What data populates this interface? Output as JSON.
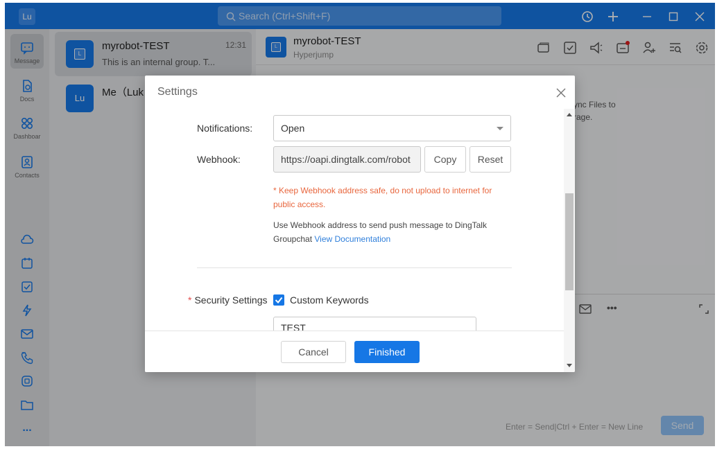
{
  "titlebar": {
    "avatar_text": "Lu",
    "search_placeholder": "Search (Ctrl+Shift+F)",
    "accent_color": "#1677e5",
    "icons": [
      "history-icon",
      "plus-icon",
      "minimize-icon",
      "maximize-icon",
      "close-icon"
    ]
  },
  "nav": {
    "items": [
      {
        "label": "Message",
        "icon": "message-icon"
      },
      {
        "label": "Docs",
        "icon": "docs-icon"
      },
      {
        "label": "Dashboar",
        "icon": "dashboard-icon"
      },
      {
        "label": "Contacts",
        "icon": "contacts-icon"
      }
    ],
    "more_label": "..."
  },
  "conversations": [
    {
      "title": "myrobot-TEST",
      "subtitle": "This is an internal group. T...",
      "time": "12:31",
      "avatar": "L"
    },
    {
      "title": "Me（Luk",
      "avatar": "Lu"
    }
  ],
  "chat": {
    "title": "myrobot-TEST",
    "subtitle": "Hyperjump",
    "avatar": "L",
    "sync_text_1": "ync Files to",
    "sync_text_2": "rage.",
    "more": "•••",
    "hint": "Enter = Send|Ctrl + Enter = New Line",
    "send_label": "Send"
  },
  "dialog": {
    "title": "Settings",
    "notifications_label": "Notifications:",
    "notifications_value": "Open",
    "webhook_label": "Webhook:",
    "webhook_value": "https://oapi.dingtalk.com/robot",
    "copy_label": "Copy",
    "reset_label": "Reset",
    "warning": "* Keep Webhook address safe, do not upload to internet for public access.",
    "info_text": "Use Webhook address to send push message to DingTalk Groupchat",
    "info_link": "View Documentation",
    "security_required": "*",
    "security_label": "Security Settings",
    "custom_keywords_label": "Custom Keywords",
    "custom_keywords_checked": true,
    "keyword_value": "TEST",
    "cancel_label": "Cancel",
    "finish_label": "Finished"
  }
}
